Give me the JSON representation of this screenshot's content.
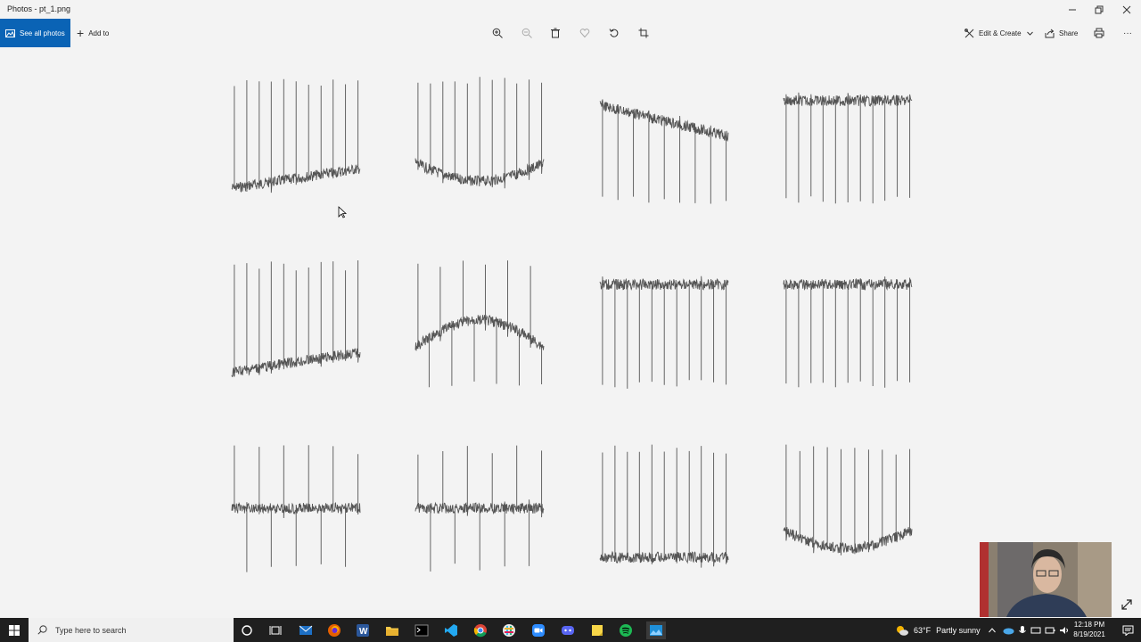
{
  "window": {
    "title": "Photos - pt_1.png"
  },
  "toolbar": {
    "see_all_label": "See all photos",
    "add_to_label": "Add to",
    "edit_create_label": "Edit & Create",
    "share_label": "Share",
    "more_label": "···"
  },
  "taskbar": {
    "search_placeholder": "Type here to search",
    "weather_temp": "63°F",
    "weather_text": "Partly sunny",
    "time": "12:18 PM",
    "date": "8/19/2021"
  },
  "icons": [
    "photos-icon",
    "plus-icon",
    "zoom-in-icon",
    "zoom-out-icon",
    "trash-icon",
    "heart-icon",
    "rotate-icon",
    "crop-icon",
    "edit-create-icon",
    "chevron-down-icon",
    "share-icon",
    "print-icon",
    "more-icon",
    "minimize-icon",
    "maximize-icon",
    "close-icon",
    "windows-start-icon",
    "search-icon",
    "cortana-icon",
    "task-view-icon",
    "mail-icon",
    "firefox-icon",
    "word-icon",
    "file-explorer-icon",
    "terminal-icon",
    "vscode-icon",
    "chrome-icon",
    "slack-icon",
    "zoom-app-icon",
    "discord-icon",
    "sticky-notes-icon",
    "spotify-icon",
    "photos-app-icon",
    "weather-icon",
    "expand-icon"
  ],
  "colors": {
    "accent": "#0a63b5",
    "trace": "#555555",
    "taskbar": "#1f1f1f"
  },
  "chart_data": {
    "type": "line",
    "layout": "3x4 grid of signal traces (ECG-like)",
    "xlabel": "",
    "ylabel": "",
    "grid": false,
    "panels": [
      {
        "baseline": "rising",
        "spikes": "up",
        "n_spikes": 11
      },
      {
        "baseline": "dip",
        "spikes": "up",
        "n_spikes": 11
      },
      {
        "baseline": "falling",
        "spikes": "down",
        "n_spikes": 9
      },
      {
        "baseline": "flat-high",
        "spikes": "down",
        "n_spikes": 11
      },
      {
        "baseline": "rising",
        "spikes": "up",
        "n_spikes": 11
      },
      {
        "baseline": "hump",
        "spikes": "up+down",
        "n_spikes": 12
      },
      {
        "baseline": "flat-high",
        "spikes": "down",
        "n_spikes": 11
      },
      {
        "baseline": "flat-high",
        "spikes": "down",
        "n_spikes": 11
      },
      {
        "baseline": "flat-mid",
        "spikes": "up+down",
        "n_spikes": 11
      },
      {
        "baseline": "flat-mid",
        "spikes": "up+down",
        "n_spikes": 11
      },
      {
        "baseline": "flat-low",
        "spikes": "up",
        "n_spikes": 11
      },
      {
        "baseline": "dip",
        "spikes": "up",
        "n_spikes": 10
      }
    ]
  }
}
